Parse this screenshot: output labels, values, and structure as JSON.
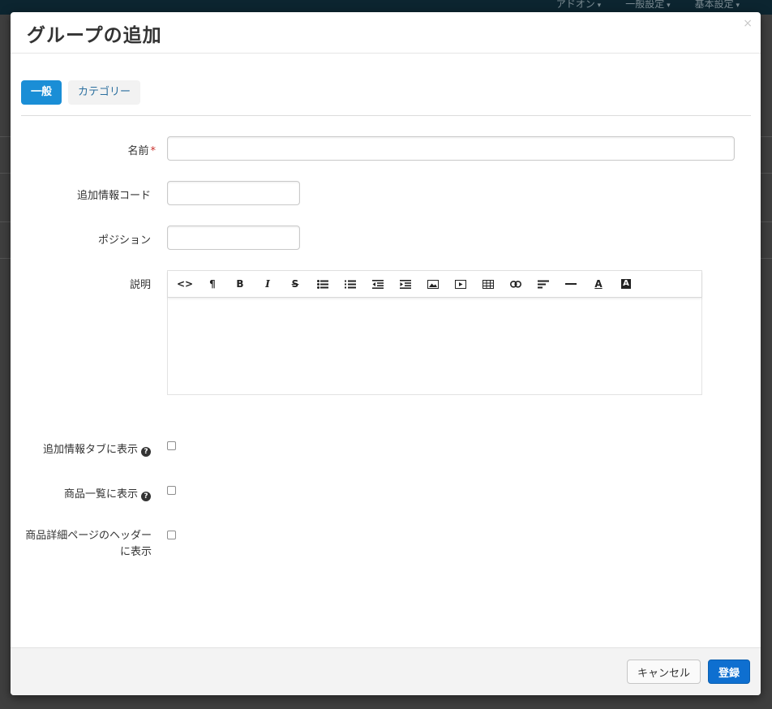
{
  "background": {
    "nav_items": [
      "アドオン",
      "一般設定",
      "基本設定"
    ]
  },
  "modal": {
    "title": "グループの追加",
    "close_symbol": "×",
    "tabs": [
      {
        "label": "一般",
        "active": true
      },
      {
        "label": "カテゴリー",
        "active": false
      }
    ],
    "fields": {
      "name_label": "名前",
      "required_mark": "*",
      "extra_code_label": "追加情報コード",
      "position_label": "ポジション",
      "description_label": "説明",
      "show_tab_label": "追加情報タブに表示",
      "show_list_label": "商品一覧に表示",
      "show_header_label": "商品詳細ページのヘッダーに表示",
      "name_value": "",
      "extra_code_value": "",
      "position_value": ""
    },
    "editor_toolbar": [
      "code-view-icon",
      "paragraph-icon",
      "bold-icon",
      "italic-icon",
      "strikethrough-icon",
      "unordered-list-icon",
      "ordered-list-icon",
      "outdent-icon",
      "indent-icon",
      "image-icon",
      "video-icon",
      "table-icon",
      "link-icon",
      "align-icon",
      "horizontal-rule-icon",
      "font-color-icon",
      "background-color-icon"
    ],
    "help_symbol": "?",
    "footer": {
      "cancel_label": "キャンセル",
      "save_label": "登録"
    }
  },
  "colors": {
    "primary": "#0e6fd0",
    "active_tab": "#1a8ed6",
    "tab_link": "#2b6f9f",
    "required": "#c9302c",
    "overlay": "#4a4a4a"
  }
}
